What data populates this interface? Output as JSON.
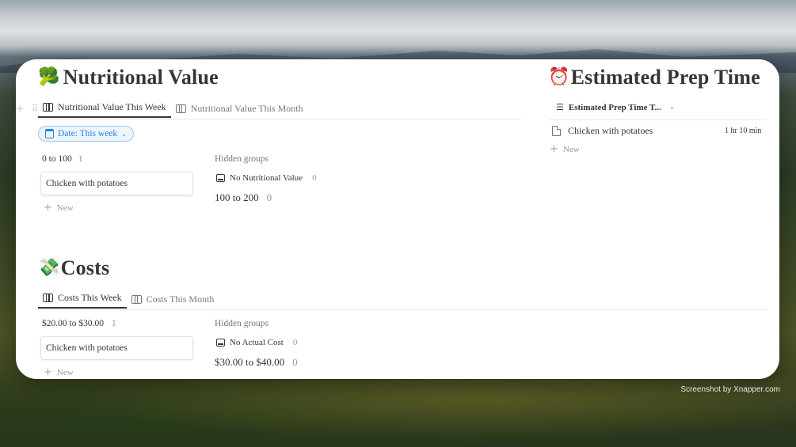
{
  "nutrition": {
    "title": "Nutritional Value",
    "emoji": "🥦",
    "tabs": [
      "Nutritional Value This Week",
      "Nutritional Value This Month"
    ],
    "filter": "Date: This week",
    "group": {
      "title": "0 to 100",
      "count": "1",
      "card": "Chicken with potatoes",
      "new": "New"
    },
    "hidden_label": "Hidden groups",
    "hidden_row": {
      "title": "No Nutritional Value",
      "count": "0"
    },
    "hidden_group2": {
      "title": "100 to 200",
      "count": "0"
    }
  },
  "prep": {
    "title": "Estimated Prep Time",
    "emoji": "⏰",
    "view": "Estimated Prep Time T...",
    "row": {
      "title": "Chicken with potatoes",
      "value": "1 hr 10 min"
    },
    "new": "New"
  },
  "costs": {
    "title": "Costs",
    "emoji": "💸",
    "tabs": [
      "Costs This Week",
      "Costs This Month"
    ],
    "group": {
      "title": "$20.00 to $30.00",
      "count": "1",
      "card": "Chicken with potatoes",
      "new": "New"
    },
    "hidden_label": "Hidden groups",
    "hidden_row": {
      "title": "No Actual Cost",
      "count": "0"
    },
    "hidden_group2": {
      "title": "$30.00 to $40.00",
      "count": "0"
    }
  },
  "caption": "Screenshot by Xnapper.com"
}
